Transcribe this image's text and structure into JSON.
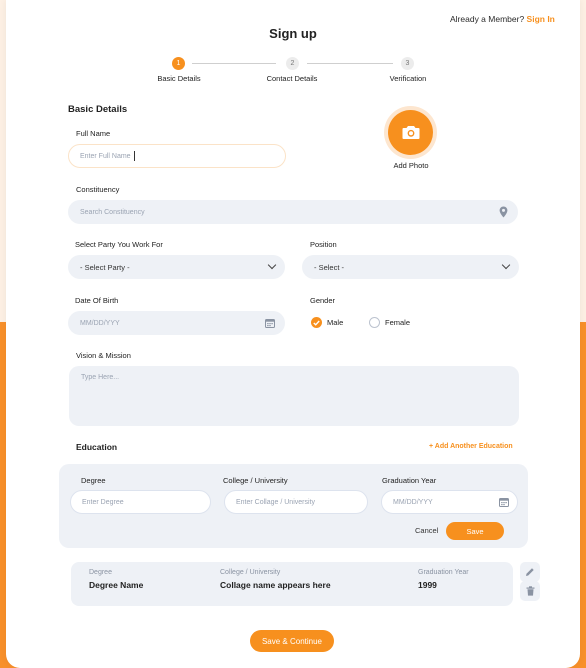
{
  "header": {
    "member_text": "Already a Member?",
    "signin_link": "Sign In",
    "title": "Sign up"
  },
  "steps": [
    {
      "number": "1",
      "label": "Basic Details",
      "active": true
    },
    {
      "number": "2",
      "label": "Contact Details",
      "active": false
    },
    {
      "number": "3",
      "label": "Verification",
      "active": false
    }
  ],
  "basic": {
    "section_title": "Basic Details",
    "full_name_label": "Full Name",
    "full_name_placeholder": "Enter Full Name",
    "add_photo": "Add Photo",
    "constituency_label": "Constituency",
    "constituency_placeholder": "Search Constituency",
    "party_label": "Select Party You Work For",
    "party_value": "- Select Party -",
    "position_label": "Position",
    "position_value": "- Select -",
    "dob_label": "Date Of Birth",
    "dob_placeholder": "MM/DD/YYY",
    "gender_label": "Gender",
    "gender_male": "Male",
    "gender_female": "Female",
    "gender_selected": "Male",
    "vision_label": "Vision & Mission",
    "vision_placeholder": "Type Here..."
  },
  "education": {
    "section_title": "Education",
    "add_another": "+ Add Another Education",
    "degree_label": "Degree",
    "degree_placeholder": "Enter Degree",
    "college_label": "College / University",
    "college_placeholder": "Enter Collage / University",
    "grad_label": "Graduation Year",
    "grad_placeholder": "MM/DD/YYY",
    "cancel": "Cancel",
    "save": "Save",
    "entry": {
      "degree_label": "Degree",
      "degree_value": "Degree Name",
      "college_label": "College / University",
      "college_value": "Collage name appears here",
      "grad_label": "Graduation Year",
      "grad_value": "1999"
    }
  },
  "footer": {
    "save_continue": "Save & Continue"
  },
  "colors": {
    "accent": "#f7901e",
    "input_bg": "#eef1f6",
    "page_bg_top": "#fdf0e4"
  }
}
